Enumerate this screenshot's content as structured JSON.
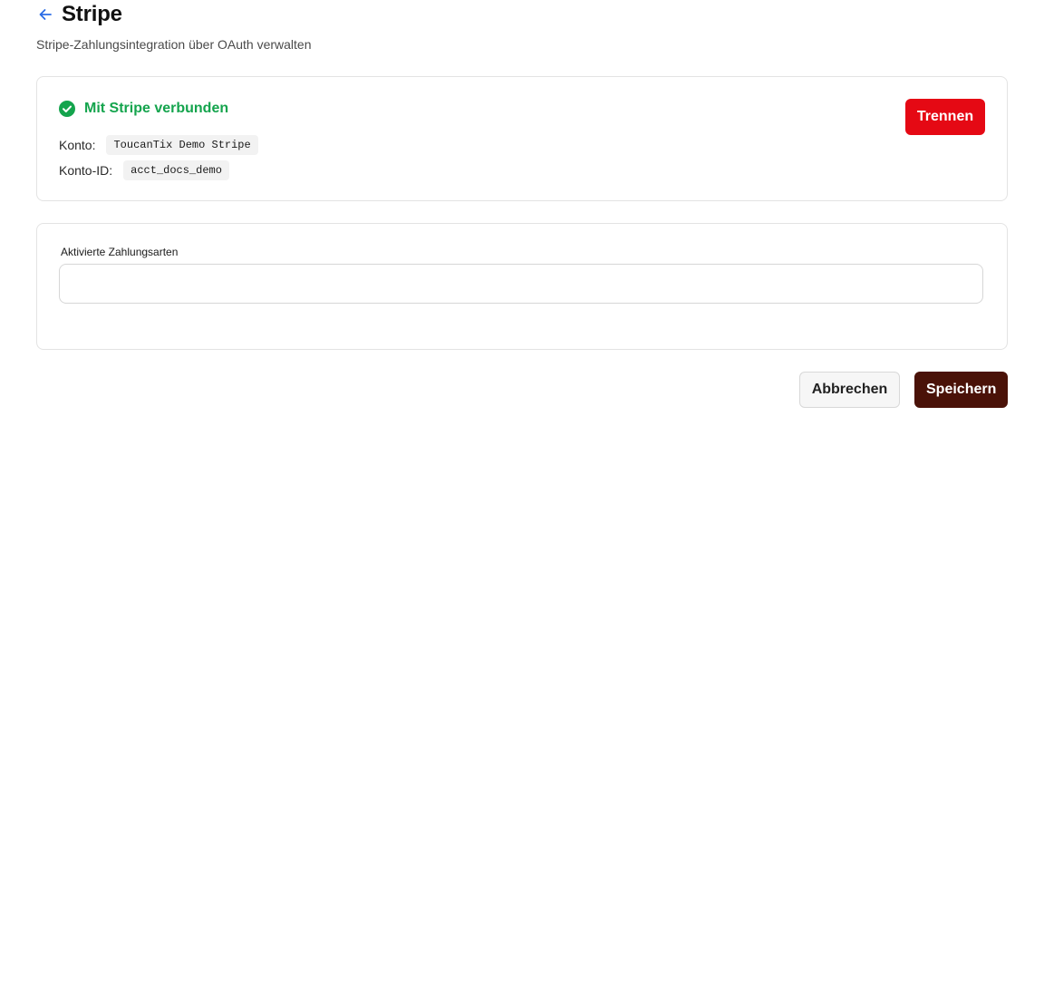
{
  "header": {
    "title": "Stripe",
    "subtitle": "Stripe-Zahlungsintegration über OAuth verwalten",
    "back_icon": "arrow-left-icon"
  },
  "connection": {
    "status_icon": "check-circle-icon",
    "status_text": "Mit Stripe verbunden",
    "status_color": "#14a44d",
    "account_label": "Konto:",
    "account_value": "ToucanTix Demo Stripe",
    "account_id_label": "Konto-ID:",
    "account_id_value": "acct_docs_demo",
    "disconnect_label": "Trennen",
    "disconnect_color": "#e50914"
  },
  "payment_methods": {
    "label": "Aktivierte Zahlungsarten",
    "value": ""
  },
  "actions": {
    "cancel_label": "Abbrechen",
    "save_label": "Speichern",
    "save_color": "#4a1208"
  }
}
